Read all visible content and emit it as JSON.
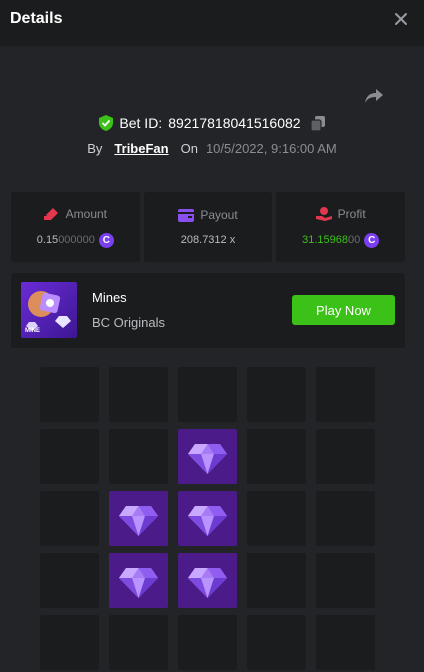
{
  "header": {
    "title": "Details"
  },
  "bet": {
    "id_label": "Bet ID:",
    "id_value": "89217818041516082",
    "by_label": "By",
    "user": "TribeFan",
    "on_label": "On",
    "date": "10/5/2022, 9:16:00 AM"
  },
  "stats": {
    "amount": {
      "label": "Amount",
      "value_main": "0.15",
      "value_dim": "000000"
    },
    "payout": {
      "label": "Payout",
      "value": "208.7312 x"
    },
    "profit": {
      "label": "Profit",
      "value_main": "31.15968",
      "value_dim": "00"
    },
    "coin_symbol": "C"
  },
  "game": {
    "name": "Mines",
    "provider": "BC Originals",
    "play_label": "Play Now",
    "thumb_tag": "MINE"
  },
  "board": {
    "columns": 5,
    "tiles": [
      "empty",
      "empty",
      "empty",
      "empty",
      "empty",
      "empty",
      "empty",
      "gem",
      "empty",
      "empty",
      "empty",
      "gem",
      "gem",
      "empty",
      "empty",
      "empty",
      "gem",
      "gem",
      "empty",
      "empty",
      "empty",
      "empty",
      "empty",
      "empty",
      "empty"
    ]
  },
  "colors": {
    "accent_green": "#3bc117",
    "coin_purple": "#7b3ff2",
    "gem_tile": "#4b1b8a",
    "icon_red": "#e2374f",
    "icon_purple": "#8a4ff0"
  }
}
